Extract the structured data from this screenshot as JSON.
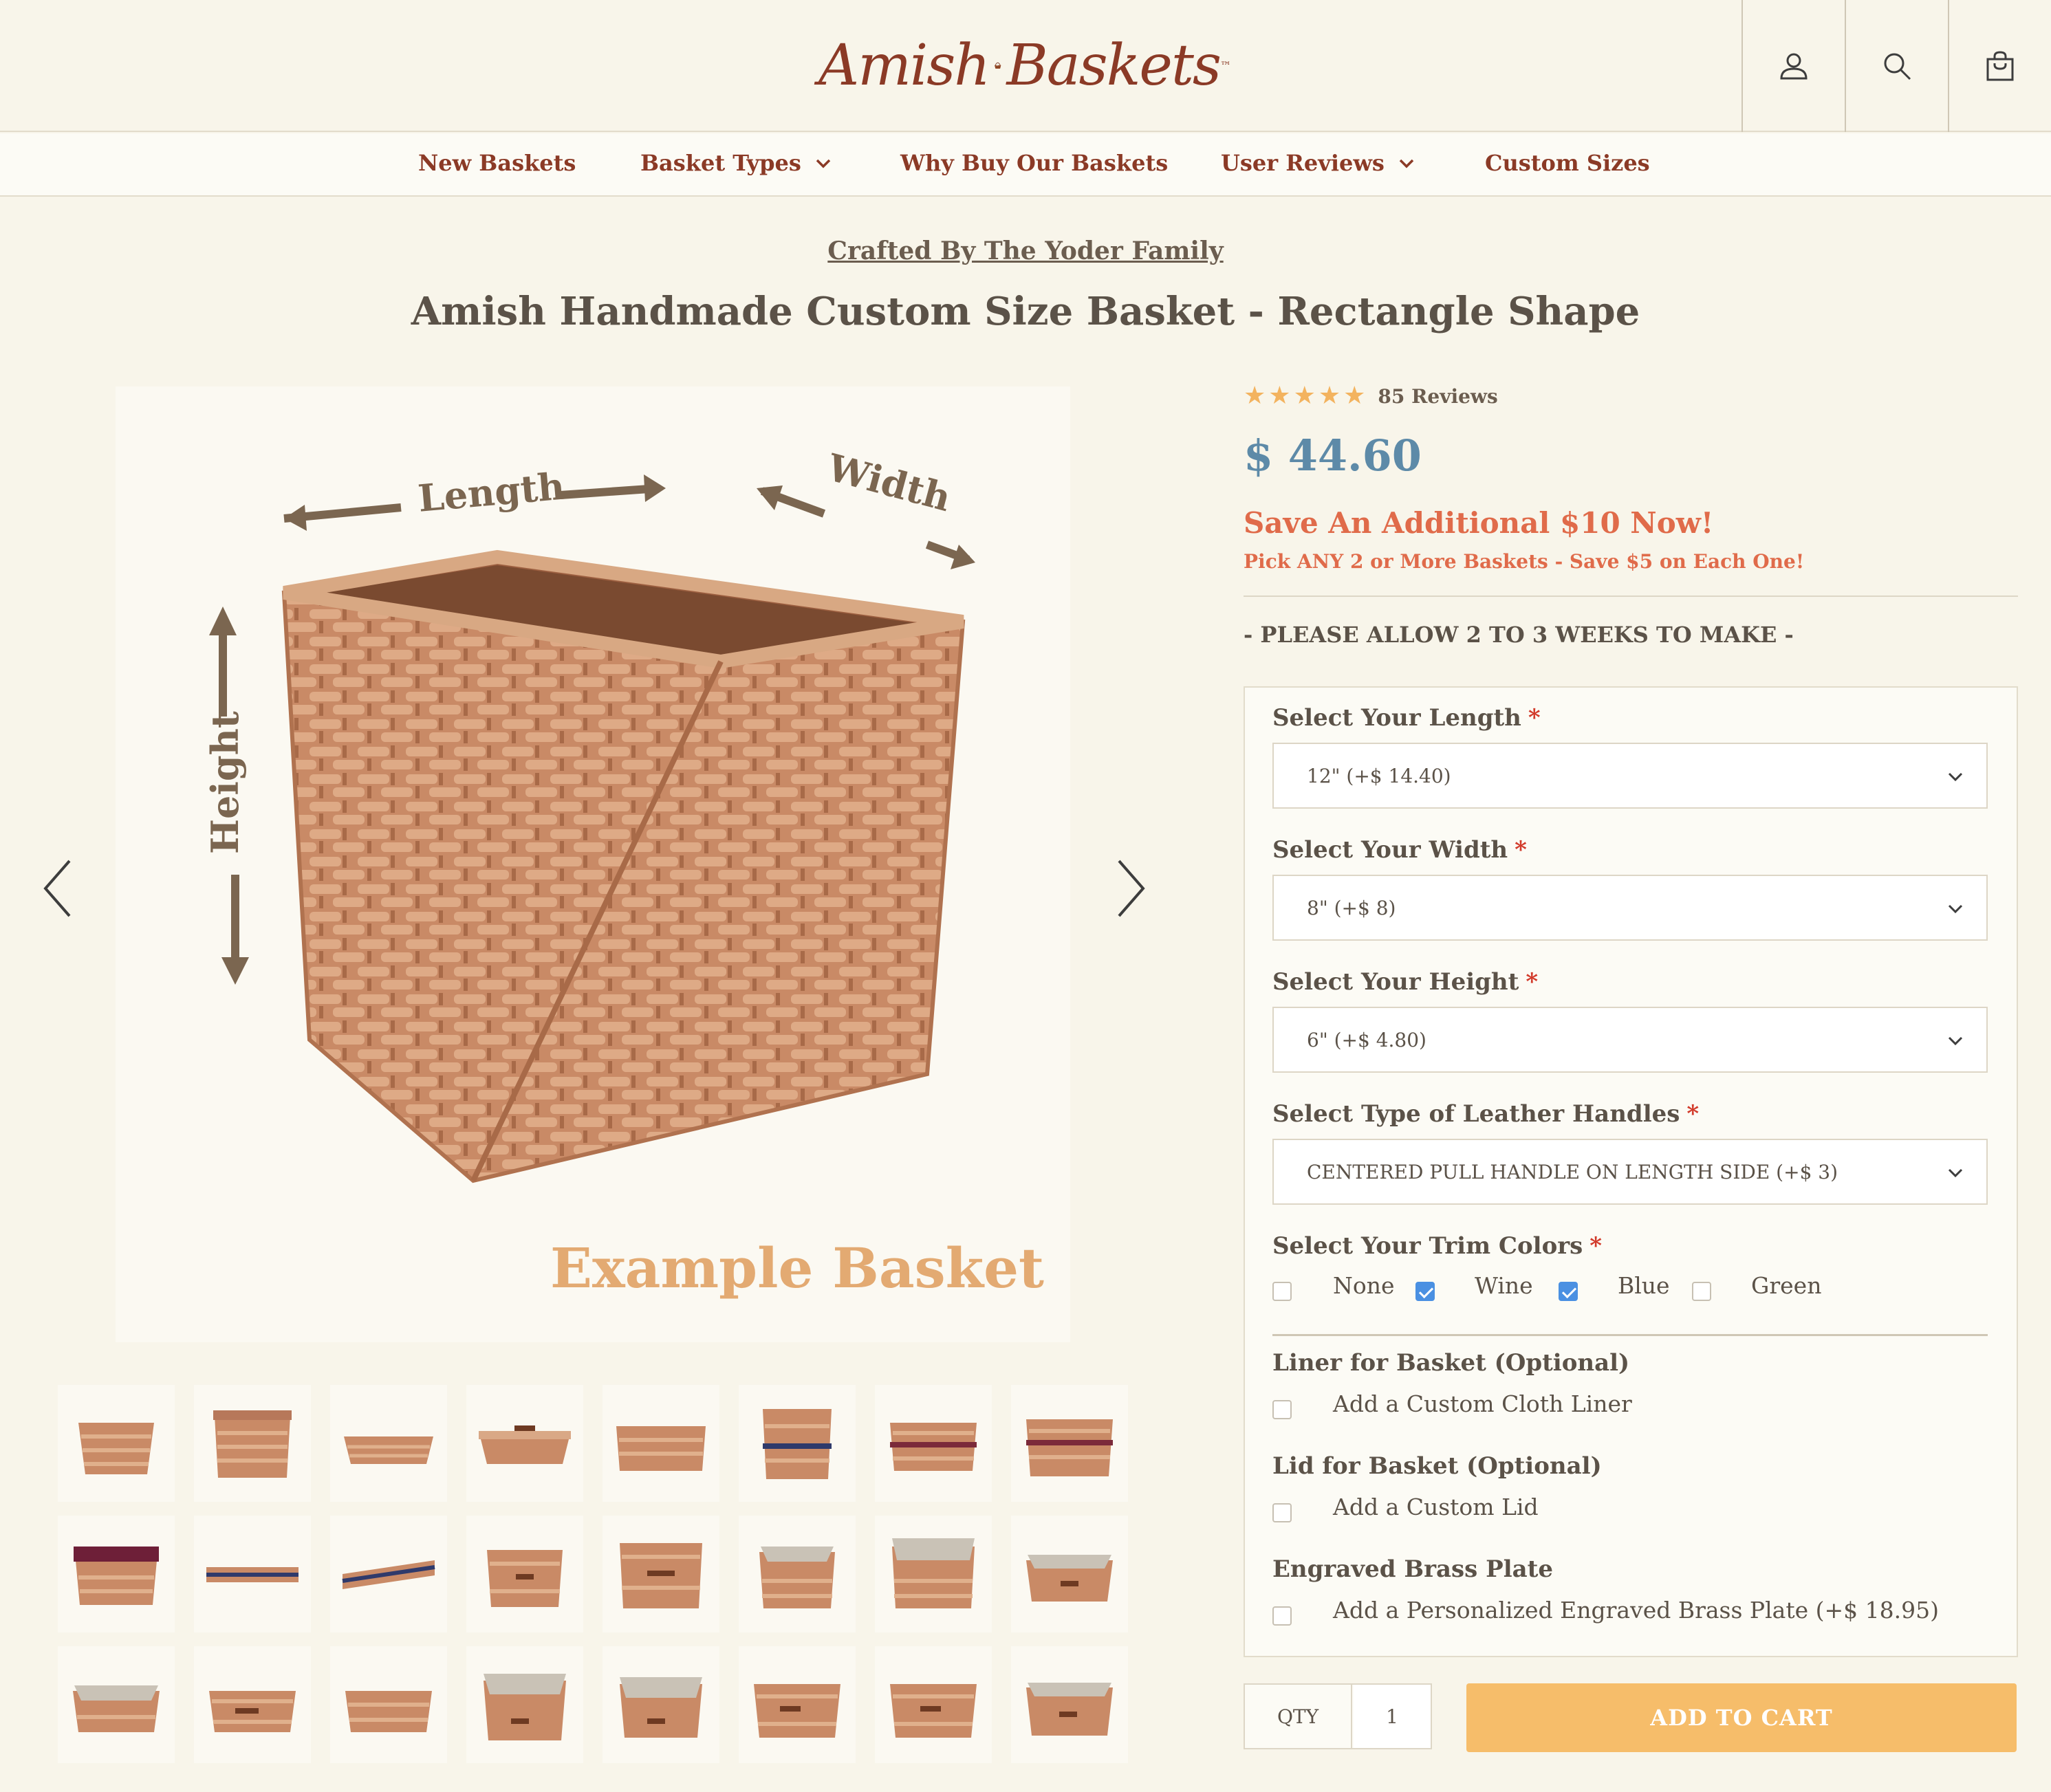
{
  "header": {
    "logo_left": "Amish",
    "logo_right": "Baskets",
    "logo_tm": "™",
    "icons": [
      "account-icon",
      "search-icon",
      "cart-icon"
    ]
  },
  "nav": {
    "items": [
      {
        "label": "New Baskets",
        "has_dropdown": false
      },
      {
        "label": "Basket Types",
        "has_dropdown": true
      },
      {
        "label": "Why Buy Our Baskets",
        "has_dropdown": false
      },
      {
        "label": "User Reviews",
        "has_dropdown": true
      },
      {
        "label": "Custom Sizes",
        "has_dropdown": false
      }
    ]
  },
  "product": {
    "crafted_by": "Crafted By The Yoder Family",
    "title": "Amish Handmade Custom Size Basket - Rectangle Shape",
    "image_labels": {
      "length": "Length",
      "width": "Width",
      "height": "Height",
      "example": "Example Basket"
    },
    "rating": 5,
    "reviews": "85 Reviews",
    "price": "$ 44.60",
    "save_headline": "Save An Additional $10 Now!",
    "save_sub": "Pick ANY 2 or More Baskets - Save $5 on Each One!",
    "allow_note": "- PLEASE ALLOW 2 TO 3 WEEKS TO MAKE -"
  },
  "options": {
    "length": {
      "label": "Select Your Length",
      "required": "*",
      "value": "12\" (+$ 14.40)"
    },
    "width": {
      "label": "Select Your Width",
      "required": "*",
      "value": "8\" (+$ 8)"
    },
    "height": {
      "label": "Select Your Height",
      "required": "*",
      "value": "6\" (+$ 4.80)"
    },
    "handles": {
      "label": "Select Type of Leather Handles",
      "required": "*",
      "value": "CENTERED PULL HANDLE ON LENGTH SIDE (+$ 3)"
    },
    "trim": {
      "label": "Select Your Trim Colors",
      "required": "*",
      "choices": [
        {
          "label": "None",
          "checked": false
        },
        {
          "label": "Wine",
          "checked": true
        },
        {
          "label": "Blue",
          "checked": true
        },
        {
          "label": "Green",
          "checked": false
        }
      ]
    },
    "liner": {
      "label": "Liner for Basket (Optional)",
      "choice": "Add a Custom Cloth Liner",
      "checked": false
    },
    "lid": {
      "label": "Lid for Basket (Optional)",
      "choice": "Add a Custom Lid",
      "checked": false
    },
    "plate": {
      "label": "Engraved Brass Plate",
      "choice": "Add a Personalized Engraved Brass Plate (+$ 18.95)",
      "checked": false
    }
  },
  "cart": {
    "qty_label": "QTY",
    "qty_value": "1",
    "add_to_cart": "ADD TO CART"
  },
  "colors": {
    "brand": "#8b3a26",
    "price": "#5d8aa8",
    "promo": "#e06b4a",
    "cart_button": "#f6bd6a",
    "checkbox_checked": "#4a90e2"
  }
}
